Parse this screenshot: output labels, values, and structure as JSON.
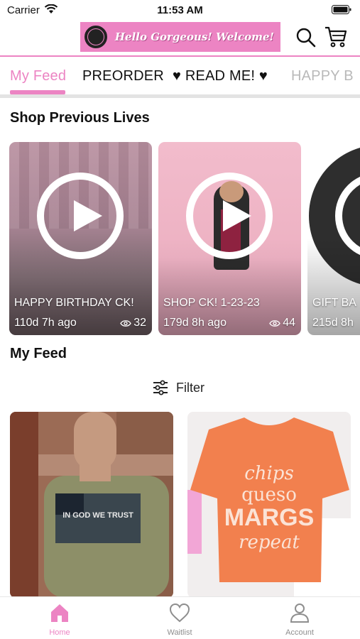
{
  "status_bar": {
    "carrier": "Carrier",
    "time": "11:53 AM"
  },
  "header": {
    "banner_text": "Hello Gorgeous! Welcome!",
    "accent_color": "#ec84c3"
  },
  "tabs": [
    {
      "label": "My Feed",
      "active": true
    },
    {
      "label": "PREORDER"
    },
    {
      "label": "♥ READ ME! ♥"
    },
    {
      "label": "HAPPY B"
    }
  ],
  "previous_lives": {
    "title": "Shop Previous Lives",
    "cards": [
      {
        "title": "HAPPY BIRTHDAY CK!",
        "age": "110d 7h ago",
        "views": "32"
      },
      {
        "title": "SHOP CK! 1-23-23",
        "age": "179d 8h ago",
        "views": "44"
      },
      {
        "title": "GIFT BA",
        "age": "215d 8h",
        "views": ""
      }
    ]
  },
  "feed": {
    "title": "My Feed",
    "filter_label": "Filter",
    "products": [
      {
        "shirt_text": "IN GOD WE TRUST"
      },
      {
        "shirt_text_line1": "chips",
        "shirt_text_line2": "queso",
        "shirt_text_line3": "MARGS",
        "shirt_text_line4": "repeat"
      }
    ]
  },
  "bottom_nav": [
    {
      "label": "Home",
      "icon": "home-icon",
      "active": true
    },
    {
      "label": "Waitlist",
      "icon": "heart-icon"
    },
    {
      "label": "Account",
      "icon": "person-icon"
    }
  ]
}
